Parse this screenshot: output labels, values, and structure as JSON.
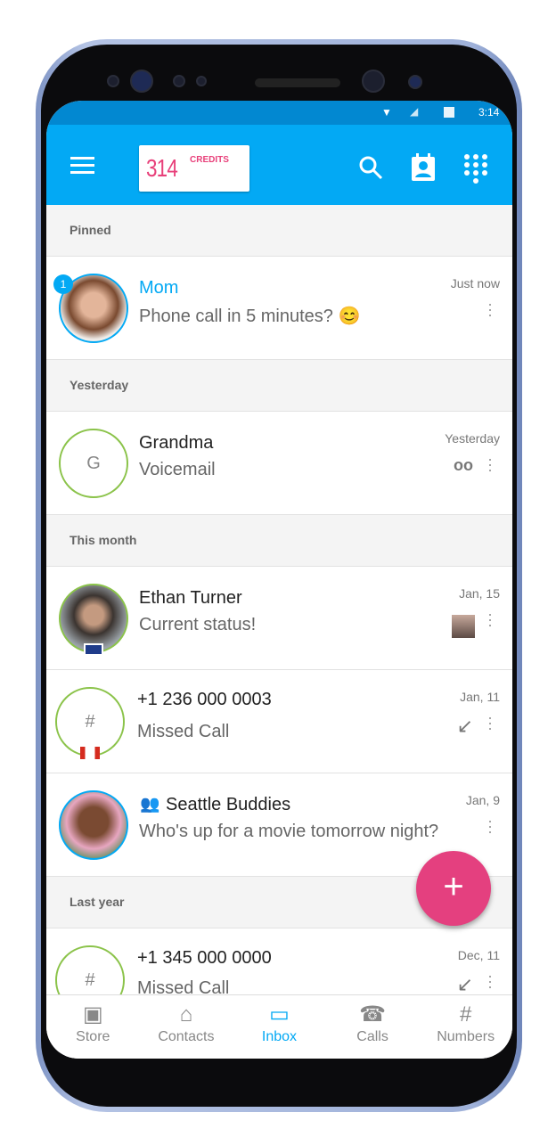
{
  "status_bar": {
    "time": "3:14"
  },
  "toolbar": {
    "credits_value": "314",
    "credits_label": "CREDITS"
  },
  "sections": [
    "Pinned",
    "Yesterday",
    "This month",
    "Last year"
  ],
  "conversations": [
    {
      "name": "Mom",
      "message": "Phone call in 5 minutes? 😊",
      "time": "Just now",
      "badge": "1"
    },
    {
      "name": "Grandma",
      "initial": "G",
      "message": "Voicemail",
      "time": "Yesterday"
    },
    {
      "name": "Ethan Turner",
      "message": "Current status!",
      "time": "Jan, 15"
    },
    {
      "name": "+1 236 000 0003",
      "initial": "#",
      "message": "Missed Call",
      "time": "Jan, 11"
    },
    {
      "name": "Seattle Buddies",
      "message": "Who's up for a movie tomorrow night?",
      "time": "Jan, 9"
    },
    {
      "name": "+1 345 000 0000",
      "initial": "#",
      "message": "Missed Call",
      "time": "Dec, 11"
    }
  ],
  "fab": {
    "label": "+"
  },
  "nav": [
    {
      "label": "Store"
    },
    {
      "label": "Contacts"
    },
    {
      "label": "Inbox",
      "active": true
    },
    {
      "label": "Calls"
    },
    {
      "label": "Numbers"
    }
  ],
  "colors": {
    "primary": "#03a9f4",
    "status": "#0288d1",
    "accent": "#e4407f",
    "ring": "#8bc34a"
  }
}
